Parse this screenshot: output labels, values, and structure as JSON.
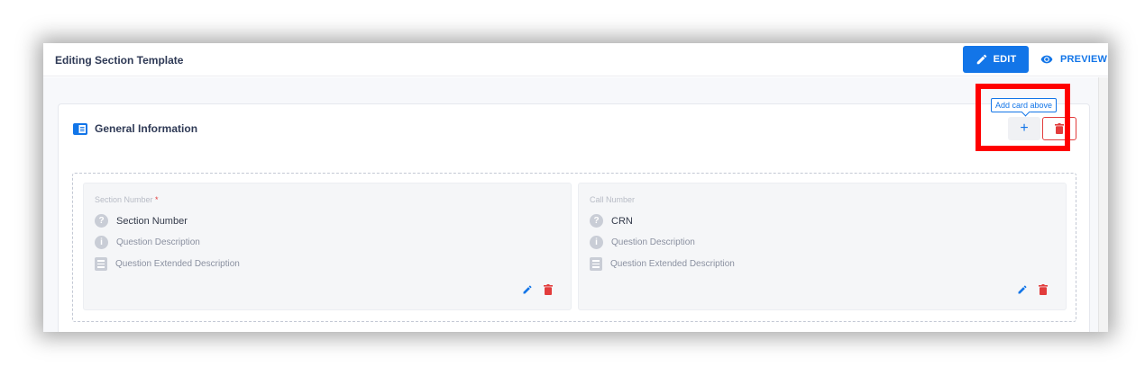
{
  "header": {
    "title": "Editing Section Template",
    "edit_label": "EDIT",
    "preview_label": "PREVIEW"
  },
  "card": {
    "title": "General Information",
    "add_label": "+",
    "tooltip": "Add card above"
  },
  "fields": [
    {
      "label": "Section Number",
      "required_mark": "*",
      "question": "Section Number",
      "description": "Question Description",
      "extended": "Question Extended Description"
    },
    {
      "label": "Call Number",
      "question": "CRN",
      "description": "Question Description",
      "extended": "Question Extended Description"
    }
  ],
  "icons": {
    "question": "?",
    "info": "i"
  },
  "colors": {
    "primary": "#1275e8",
    "danger": "#e23c3c",
    "highlight": "#ff0000"
  }
}
